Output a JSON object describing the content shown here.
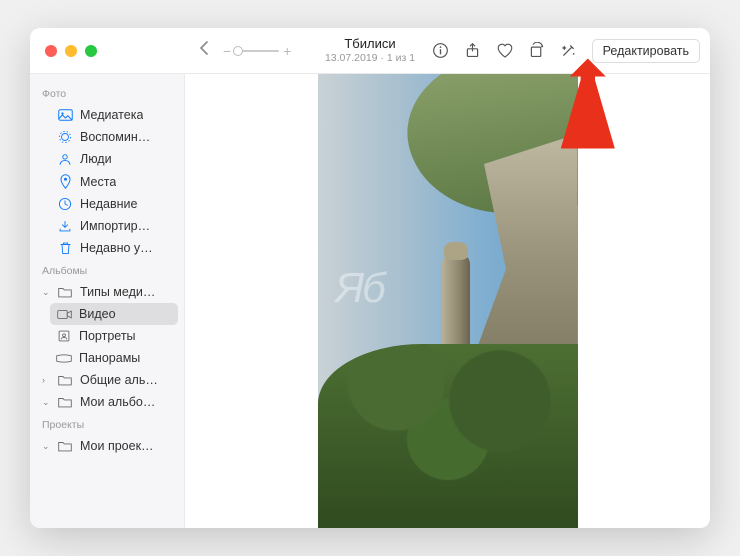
{
  "window": {
    "title": "Тбилиси",
    "subtitle": "13.07.2019 · 1 из 1"
  },
  "toolbar": {
    "edit_label": "Редактировать"
  },
  "sidebar": {
    "sections": [
      {
        "title": "Фото",
        "items": [
          {
            "icon": "library-icon",
            "label": "Медиатека"
          },
          {
            "icon": "memories-icon",
            "label": "Воспомин…"
          },
          {
            "icon": "people-icon",
            "label": "Люди"
          },
          {
            "icon": "places-icon",
            "label": "Места"
          },
          {
            "icon": "recent-icon",
            "label": "Недавние"
          },
          {
            "icon": "import-icon",
            "label": "Импортир…"
          },
          {
            "icon": "trash-icon",
            "label": "Недавно у…"
          }
        ]
      },
      {
        "title": "Альбомы",
        "items": [
          {
            "icon": "folder-icon",
            "label": "Типы меди…",
            "expandable": true,
            "expanded": true
          },
          {
            "icon": "video-icon",
            "label": "Видео",
            "indent": true,
            "selected": true
          },
          {
            "icon": "portrait-icon",
            "label": "Портреты",
            "indent": true
          },
          {
            "icon": "panorama-icon",
            "label": "Панорамы",
            "indent": true
          },
          {
            "icon": "folder-icon",
            "label": "Общие аль…",
            "expandable": true
          },
          {
            "icon": "folder-icon",
            "label": "Мои альбо…",
            "expandable": true,
            "expanded": true
          }
        ]
      },
      {
        "title": "Проекты",
        "items": [
          {
            "icon": "folder-icon",
            "label": "Мои проек…",
            "expandable": true,
            "expanded": true
          }
        ]
      }
    ]
  },
  "watermark": "Яб"
}
